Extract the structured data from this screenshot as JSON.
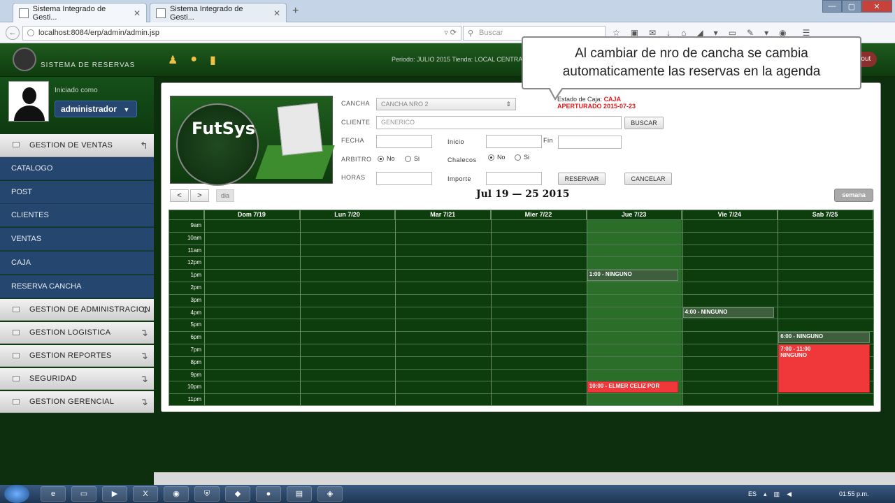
{
  "browser": {
    "tabs": [
      {
        "title": "Sistema Integrado de Gesti..."
      },
      {
        "title": "Sistema Integrado de Gesti..."
      }
    ],
    "url": "localhost:8084/erp/admin/admin.jsp",
    "search_placeholder": "Buscar"
  },
  "header": {
    "system_name": "SISTEMA DE RESERVAS",
    "periodo": "Periodo: JULIO 2015 Tienda: LOCAL CENTRAL",
    "logout": "Logout"
  },
  "user": {
    "iniciado_label": "Iniciado como",
    "name": "administrador"
  },
  "sidebar": {
    "groups": [
      {
        "label": "GESTION DE VENTAS"
      },
      {
        "label": "GESTION DE ADMINISTRACION"
      },
      {
        "label": "GESTION LOGISTICA"
      },
      {
        "label": "GESTION REPORTES"
      },
      {
        "label": "SEGURIDAD"
      },
      {
        "label": "GESTION GERENCIAL"
      }
    ],
    "items": [
      {
        "label": "CATALOGO"
      },
      {
        "label": "POST"
      },
      {
        "label": "CLIENTES"
      },
      {
        "label": "VENTAS"
      },
      {
        "label": "CAJA"
      },
      {
        "label": "RESERVA CANCHA"
      }
    ]
  },
  "logo": {
    "brand": "FutSys"
  },
  "form": {
    "cancha_label": "CANCHA",
    "cancha_value": "CANCHA NRO 2",
    "cliente_label": "CLIENTE",
    "cliente_value": "GENERICO",
    "buscar": "BUSCAR",
    "fecha_label": "FECHA",
    "inicio_label": "Inicio",
    "fin_label": "Fin",
    "arbitro_label": "ARBITRO",
    "chalecos_label": "Chalecos",
    "no": "No",
    "si": "Si",
    "horas_label": "HORAS",
    "importe_label": "Importe",
    "reservar": "RESERVAR",
    "cancelar": "CANCELAR",
    "estado_label": "Estado de Caja:",
    "estado_value": "CAJA",
    "estado_line2": "APERTURADO 2015-07-23"
  },
  "calendar": {
    "prev": "<",
    "next": ">",
    "dia": "dia",
    "range": "Jul 19 — 25 2015",
    "semana": "semana",
    "days": [
      "Dom 7/19",
      "Lun 7/20",
      "Mar 7/21",
      "Mier 7/22",
      "Jue 7/23",
      "Vie 7/24",
      "Sab 7/25"
    ],
    "hours": [
      "9am",
      "10am",
      "11am",
      "12pm",
      "1pm",
      "2pm",
      "3pm",
      "4pm",
      "5pm",
      "6pm",
      "7pm",
      "8pm",
      "9pm",
      "10pm",
      "11pm"
    ],
    "events": [
      {
        "text": "1:00 - NINGUNO",
        "color": "gray"
      },
      {
        "text": "4:00 - NINGUNO",
        "color": "gray"
      },
      {
        "text": "6:00 - NINGUNO",
        "color": "gray"
      },
      {
        "text": "7:00 - 11:00",
        "text2": "NINGUNO",
        "color": "red"
      },
      {
        "text": "10:00 - ELMER CELIZ POR",
        "color": "red"
      }
    ]
  },
  "tooltip": {
    "line1": "Al cambiar de nro de cancha se cambia",
    "line2": "automaticamente las reservas en la agenda"
  },
  "taskbar": {
    "lang": "ES",
    "clock": "01:55 p.m."
  },
  "colors": {
    "header_green": "#1e5a1e",
    "sidebar_blue": "#25466e",
    "event_red": "#f0383a"
  }
}
